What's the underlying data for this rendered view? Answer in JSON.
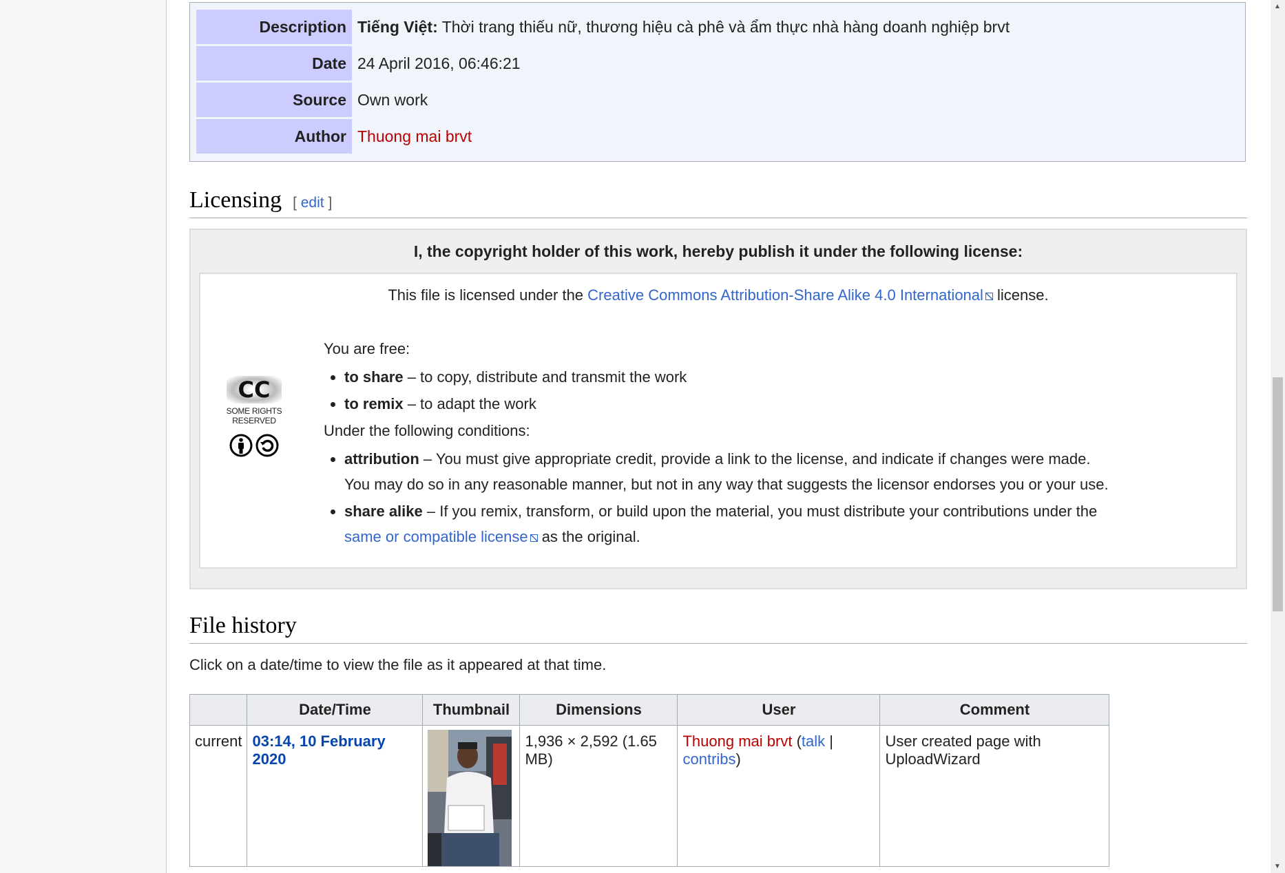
{
  "info": {
    "rows": [
      {
        "key": "Description",
        "lang": "Tiếng Việt:",
        "value": "Thời trang thiếu nữ, thương hiệu cà phê và ẩm thực nhà hàng doanh nghiệp brvt"
      },
      {
        "key": "Date",
        "value": "24 April 2016, 06:46:21"
      },
      {
        "key": "Source",
        "value": "Own work"
      },
      {
        "key": "Author",
        "value": "Thuong mai brvt"
      }
    ]
  },
  "licensing": {
    "heading": "Licensing",
    "edit": "edit",
    "header": "I, the copyright holder of this work, hereby publish it under the following license:",
    "intro_pre": "This file is licensed under the ",
    "intro_link": "Creative Commons Attribution-Share Alike 4.0 International",
    "intro_post": " license.",
    "badge_text": "SOME RIGHTS RESERVED",
    "badge_mark": "CC",
    "free_heading": "You are free:",
    "free": [
      {
        "term": "to share",
        "desc": " – to copy, distribute and transmit the work"
      },
      {
        "term": "to remix",
        "desc": " – to adapt the work"
      }
    ],
    "cond_heading": "Under the following conditions:",
    "attribution_term": "attribution",
    "attribution_desc": " – You must give appropriate credit, provide a link to the license, and indicate if changes were made. You may do so in any reasonable manner, but not in any way that suggests the licensor endorses you or your use.",
    "sharealike_term": "share alike",
    "sharealike_desc": " – If you remix, transform, or build upon the material, you must distribute your contributions under the ",
    "sharealike_link": "same or compatible license",
    "sharealike_post": " as the original."
  },
  "history": {
    "heading": "File history",
    "note": "Click on a date/time to view the file as it appeared at that time.",
    "columns": [
      "",
      "Date/Time",
      "Thumbnail",
      "Dimensions",
      "User",
      "Comment"
    ],
    "row": {
      "status": "current",
      "datetime": "03:14, 10 February 2020",
      "dimensions": "1,936 × 2,592 (1.65 MB)",
      "user": "Thuong mai brvt",
      "paren_open": " (",
      "talk": "talk",
      "sep": " | ",
      "contribs": "contribs",
      "paren_close": ")",
      "comment": "User created page with UploadWizard"
    }
  },
  "colors": {
    "link": "#3366cc",
    "redlink": "#ba0000",
    "key_bg": "#ccccff"
  }
}
